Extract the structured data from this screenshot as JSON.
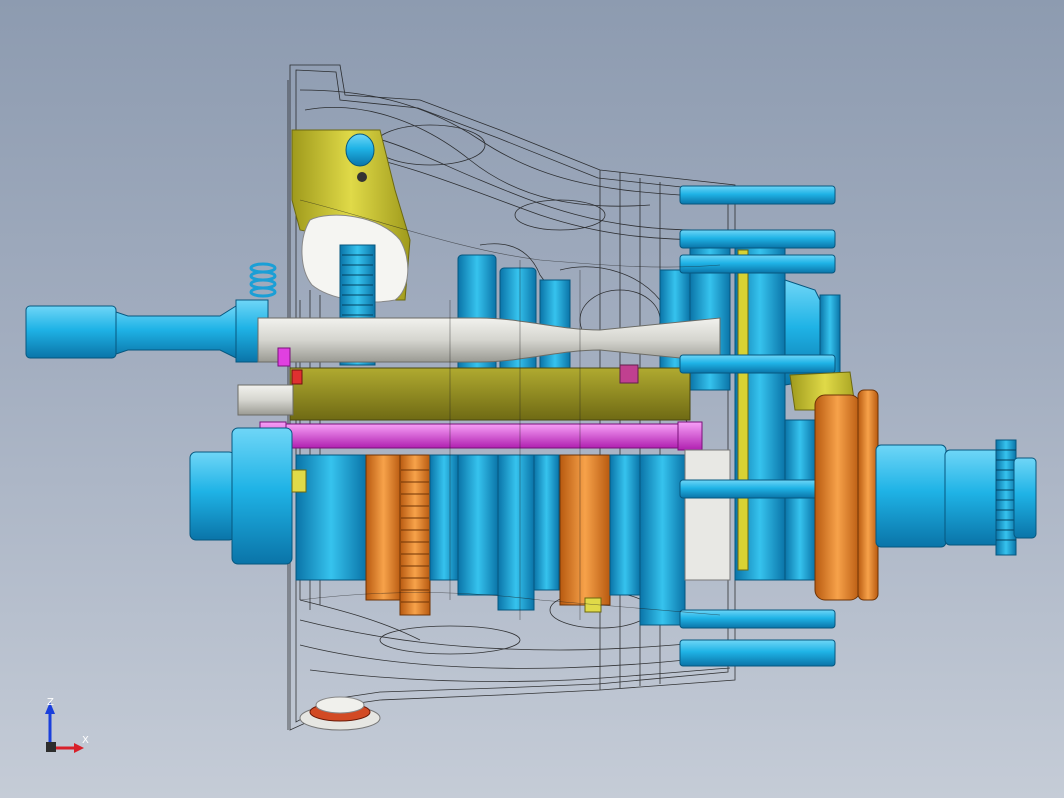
{
  "viewport": {
    "title": "",
    "background_top": "#8d9bb0",
    "background_bottom": "#c5ccd7"
  },
  "model": {
    "description_hidden": true,
    "colors": {
      "shaft_blue": "#1fb3e6",
      "shaft_blue_dark": "#0a74a8",
      "gear_orange": "#f08a25",
      "housing_yellow": "#c9c230",
      "rail_olive": "#8f8a22",
      "pin_magenta": "#e040e0",
      "rod_gray": "#d9d9d4",
      "wireframe": "#1a1a1a"
    }
  },
  "triad": {
    "z_label": "Z",
    "x_label": "X",
    "z_color": "#1a3fdc",
    "x_color": "#d8202a"
  }
}
